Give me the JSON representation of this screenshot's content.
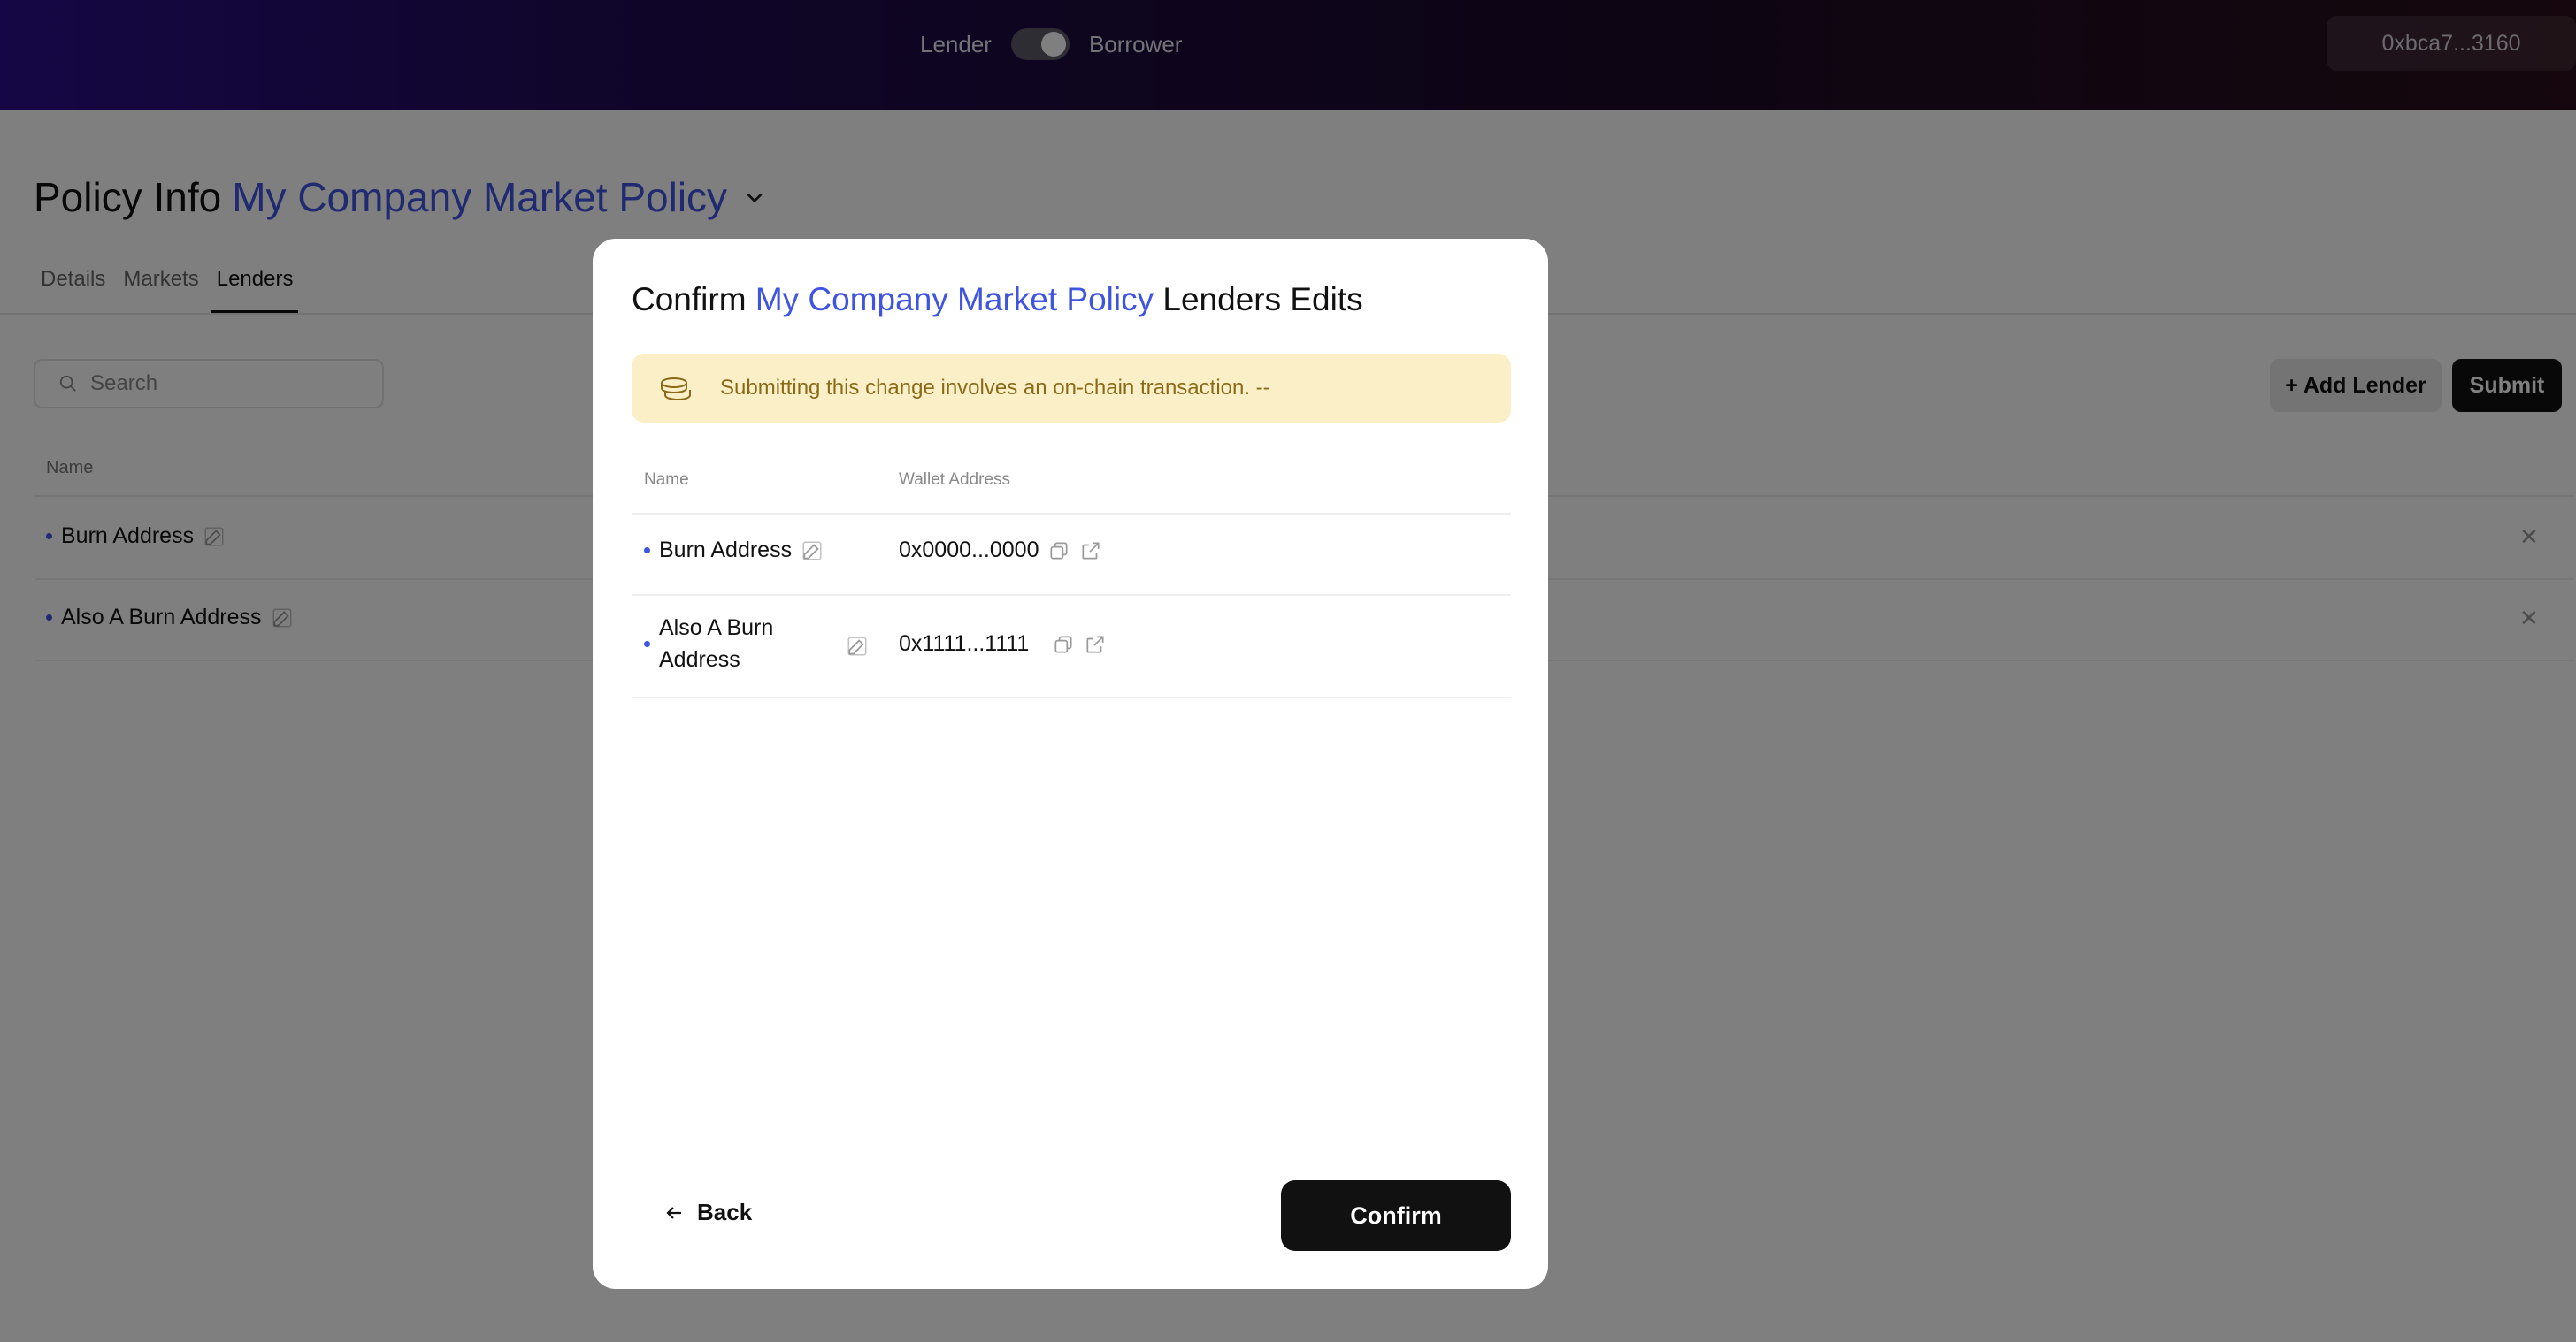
{
  "topbar": {
    "lender_label": "Lender",
    "borrower_label": "Borrower",
    "wallet_address": "0xbca7...3160"
  },
  "page": {
    "title_prefix": "Policy Info",
    "policy_name": "My Company Market Policy",
    "tabs": [
      {
        "label": "Details",
        "active": false
      },
      {
        "label": "Markets",
        "active": false
      },
      {
        "label": "Lenders",
        "active": true
      }
    ],
    "search_placeholder": "Search",
    "add_lender_label": "+ Add Lender",
    "submit_label": "Submit",
    "list_header_name": "Name",
    "rows": [
      {
        "name": "Burn Address"
      },
      {
        "name": "Also A Burn Address"
      }
    ]
  },
  "modal": {
    "title_prefix": "Confirm",
    "policy_name": "My Company Market Policy",
    "title_suffix": "Lenders Edits",
    "warning_text": "Submitting this change involves an on-chain transaction. --",
    "columns": {
      "name": "Name",
      "wallet": "Wallet Address"
    },
    "rows": [
      {
        "name": "Burn Address",
        "wallet": "0x0000...0000"
      },
      {
        "name_line1": "Also A Burn",
        "name_line2": "Address",
        "wallet": "0x1111...1111"
      }
    ],
    "back_label": "Back",
    "confirm_label": "Confirm"
  },
  "colors": {
    "accent": "#3f55e0",
    "warning_bg": "#fbefc8",
    "warning_text": "#8a6a16",
    "primary_button": "#111111"
  },
  "icons": [
    "chevron-down-icon",
    "search-icon",
    "edit-icon",
    "close-icon",
    "coins-icon",
    "copy-icon",
    "external-link-icon",
    "arrow-left-icon"
  ]
}
